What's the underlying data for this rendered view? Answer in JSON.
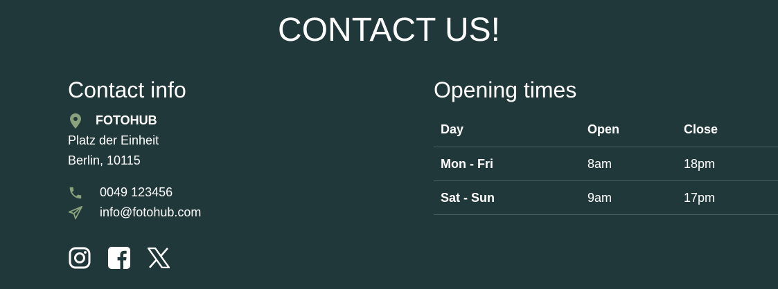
{
  "page": {
    "title": "CONTACT US!"
  },
  "contact_info": {
    "heading": "Contact info",
    "company": "FOTOHUB",
    "address_lines": [
      "Platz der Einheit",
      "Berlin, 10115"
    ],
    "phone": "0049 123456",
    "email": "info@fotohub.com",
    "icons": {
      "location": "map-pin-icon",
      "phone": "phone-icon",
      "email": "paper-plane-icon"
    },
    "socials": [
      {
        "name": "instagram-icon"
      },
      {
        "name": "facebook-icon"
      },
      {
        "name": "x-icon"
      }
    ]
  },
  "opening_times": {
    "heading": "Opening times",
    "columns": [
      "Day",
      "Open",
      "Close"
    ],
    "rows": [
      {
        "day": "Mon - Fri",
        "open": "8am",
        "close": "18pm"
      },
      {
        "day": "Sat - Sun",
        "open": "9am",
        "close": "17pm"
      }
    ]
  },
  "colors": {
    "background": "#21383b",
    "accent": "#8aa27b",
    "text": "#ffffff"
  }
}
